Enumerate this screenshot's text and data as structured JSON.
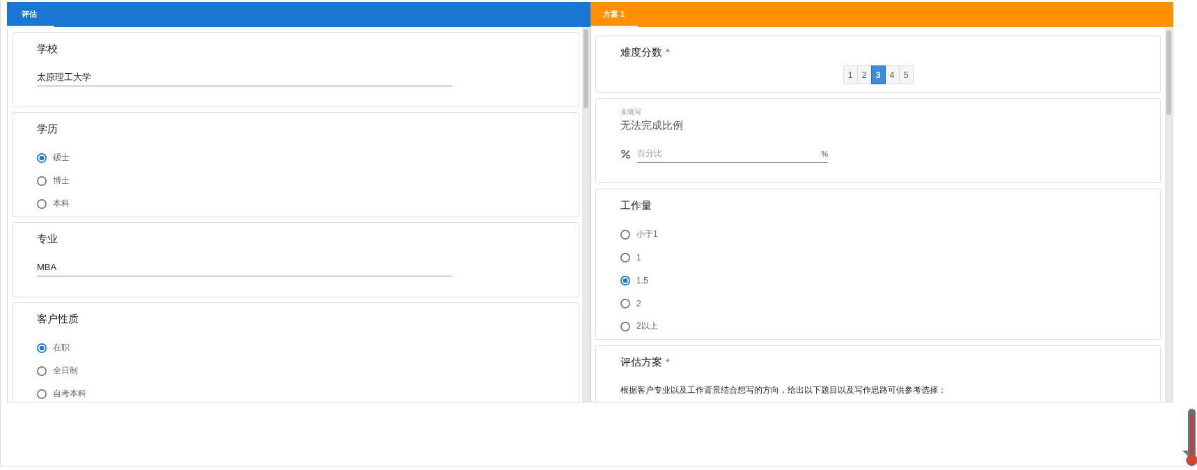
{
  "panels": [
    {
      "color": "#1976d2",
      "tab": {
        "label": "评估",
        "selected": true
      },
      "cards": [
        {
          "kind": "text",
          "title": "学校",
          "value": "太原理工大学"
        },
        {
          "kind": "radio",
          "title": "学历",
          "options": [
            {
              "label": "硕士",
              "selected": true
            },
            {
              "label": "博士",
              "selected": false
            },
            {
              "label": "本科",
              "selected": false
            }
          ]
        },
        {
          "kind": "text",
          "title": "专业",
          "value": "MBA"
        },
        {
          "kind": "radio",
          "title": "客户性质",
          "options": [
            {
              "label": "在职",
              "selected": true
            },
            {
              "label": "全日制",
              "selected": false
            },
            {
              "label": "自考本科",
              "selected": false
            }
          ]
        }
      ]
    },
    {
      "color": "#ff9100",
      "tab": {
        "label": "方案 1",
        "selected": true
      },
      "cards": [
        {
          "kind": "rating",
          "title": "难度分数",
          "required_mark": "*",
          "options": [
            {
              "label": "1",
              "selected": false
            },
            {
              "label": "2",
              "selected": false
            },
            {
              "label": "3",
              "selected": true
            },
            {
              "label": "4",
              "selected": false
            },
            {
              "label": "5",
              "selected": false
            }
          ]
        },
        {
          "kind": "percent",
          "status": "未填写",
          "title": "无法完成比例",
          "placeholder": "百分比",
          "suffix": "%"
        },
        {
          "kind": "radio",
          "title": "工作量",
          "options": [
            {
              "label": "小于1",
              "selected": false
            },
            {
              "label": "1",
              "selected": false
            },
            {
              "label": "1.5",
              "selected": true
            },
            {
              "label": "2",
              "selected": false
            },
            {
              "label": "2以上",
              "selected": false
            }
          ]
        },
        {
          "kind": "note",
          "title": "评估方案",
          "required_mark": "*",
          "text": "根据客户专业以及工作背景结合想写的方向，给出以下题目以及写作思路可供参考选择："
        }
      ]
    }
  ]
}
